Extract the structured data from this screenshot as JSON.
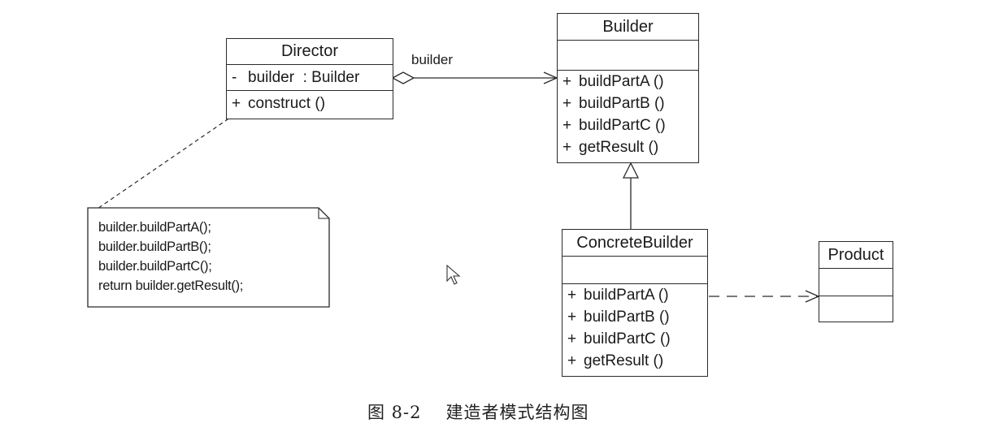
{
  "diagram": {
    "classes": {
      "director": {
        "name": "Director",
        "attributes": [
          {
            "visibility": "-",
            "text": "builder  : Builder"
          }
        ],
        "operations": [
          {
            "visibility": "+",
            "text": "construct ()"
          }
        ]
      },
      "builder": {
        "name": "Builder",
        "attributes": [],
        "operations": [
          {
            "visibility": "+",
            "text": "buildPartA ()"
          },
          {
            "visibility": "+",
            "text": "buildPartB ()"
          },
          {
            "visibility": "+",
            "text": "buildPartC ()"
          },
          {
            "visibility": "+",
            "text": "getResult ()"
          }
        ]
      },
      "concrete_builder": {
        "name": "ConcreteBuilder",
        "attributes": [],
        "operations": [
          {
            "visibility": "+",
            "text": "buildPartA ()"
          },
          {
            "visibility": "+",
            "text": "buildPartB ()"
          },
          {
            "visibility": "+",
            "text": "buildPartC ()"
          },
          {
            "visibility": "+",
            "text": "getResult ()"
          }
        ]
      },
      "product": {
        "name": "Product",
        "attributes": [],
        "operations": []
      }
    },
    "note": {
      "lines": [
        "builder.buildPartA();",
        "builder.buildPartB();",
        "builder.buildPartC();",
        "return builder.getResult();"
      ]
    },
    "relations": [
      {
        "type": "aggregation",
        "from": "Director",
        "to": "Builder",
        "label": "builder"
      },
      {
        "type": "generalization",
        "from": "ConcreteBuilder",
        "to": "Builder",
        "label": ""
      },
      {
        "type": "dependency",
        "from": "ConcreteBuilder",
        "to": "Product",
        "label": ""
      },
      {
        "type": "note-anchor",
        "from": "Note",
        "to": "Director.construct",
        "label": ""
      }
    ],
    "association_label": "builder",
    "caption": {
      "figure": "图 8-2",
      "title": "建造者模式结构图"
    }
  }
}
